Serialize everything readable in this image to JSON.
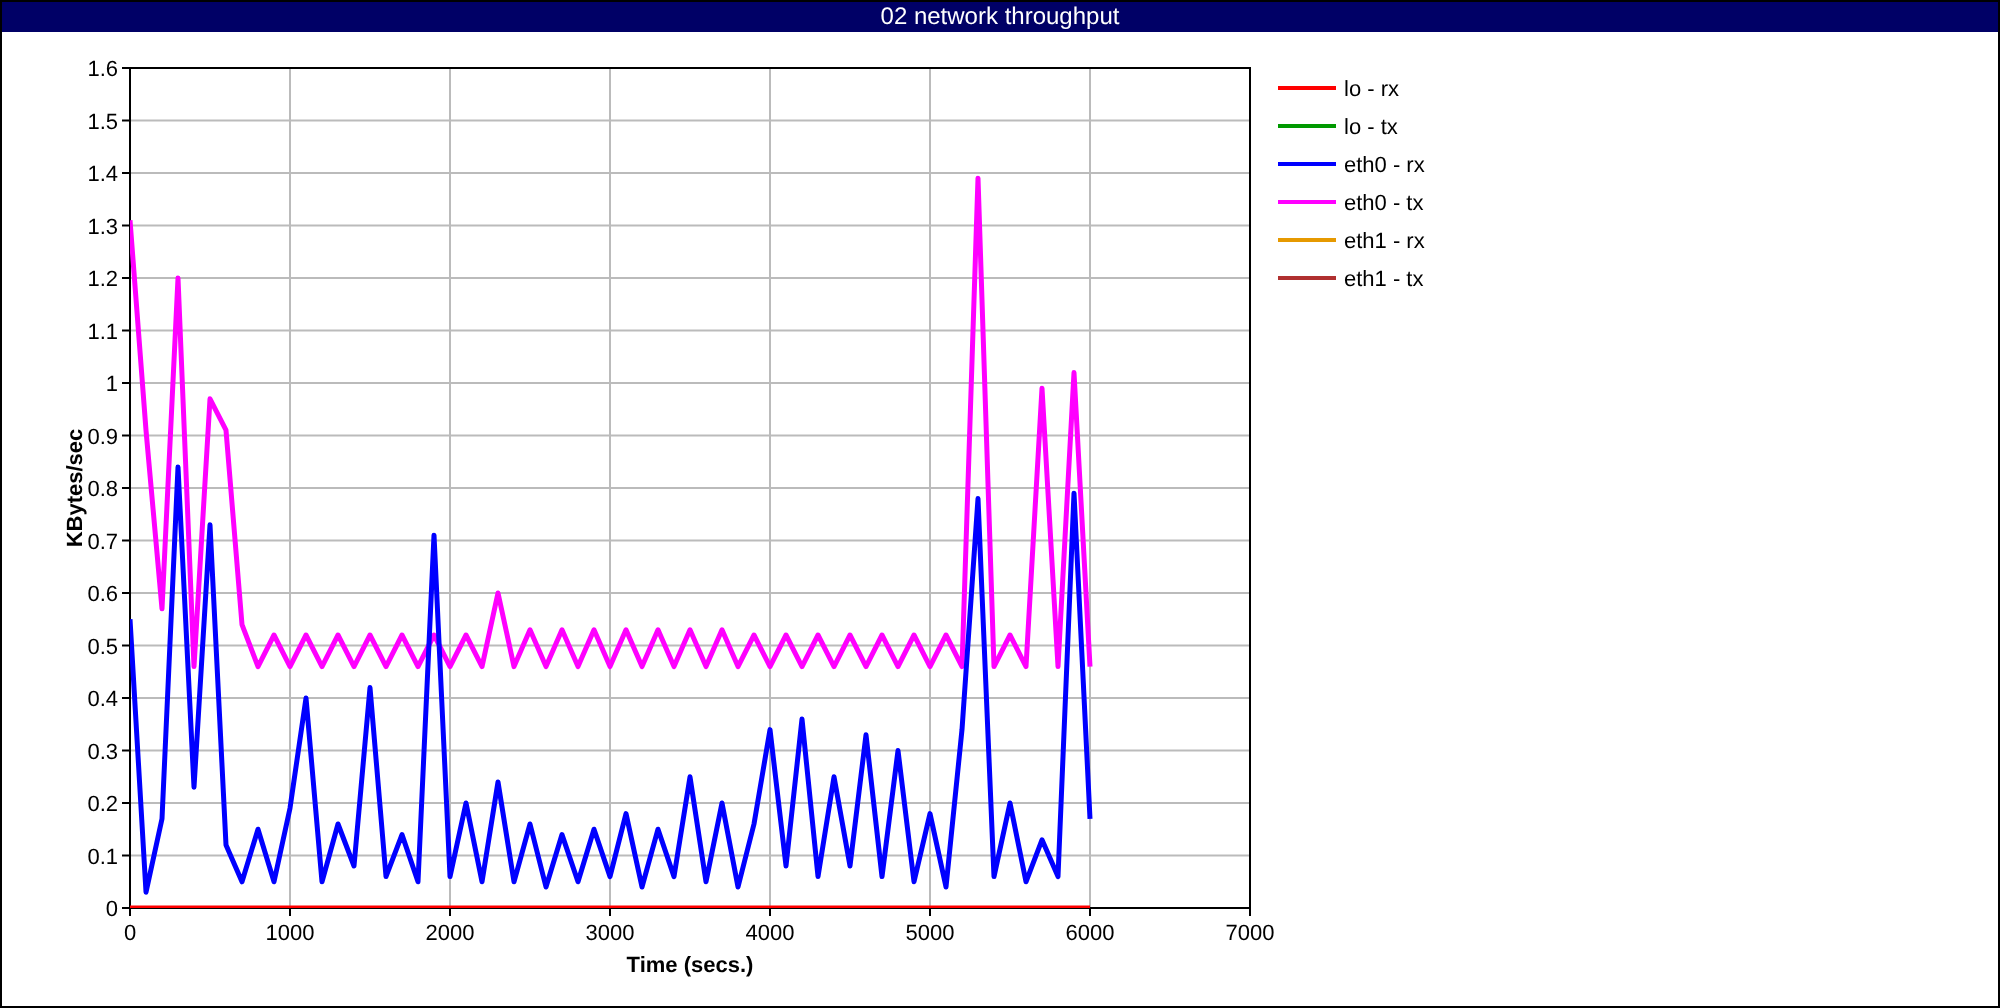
{
  "window": {
    "title": "02 network throughput"
  },
  "chart_data": {
    "type": "line",
    "xlabel": "Time (secs.)",
    "ylabel": "KBytes/sec",
    "xlim": [
      0,
      7000
    ],
    "ylim": [
      0,
      1.6
    ],
    "grid": true,
    "legend": true,
    "xticks": [
      0,
      1000,
      2000,
      3000,
      4000,
      5000,
      6000,
      7000
    ],
    "yticks": [
      0,
      0.1,
      0.2,
      0.3,
      0.4,
      0.5,
      0.6,
      0.7,
      0.8,
      0.9,
      1,
      1.1,
      1.2,
      1.3,
      1.4,
      1.5,
      1.6
    ],
    "x": [
      0,
      100,
      200,
      300,
      400,
      500,
      600,
      700,
      800,
      900,
      1000,
      1100,
      1200,
      1300,
      1400,
      1500,
      1600,
      1700,
      1800,
      1900,
      2000,
      2100,
      2200,
      2300,
      2400,
      2500,
      2600,
      2700,
      2800,
      2900,
      3000,
      3100,
      3200,
      3300,
      3400,
      3500,
      3600,
      3700,
      3800,
      3900,
      4000,
      4100,
      4200,
      4300,
      4400,
      4500,
      4600,
      4700,
      4800,
      4900,
      5000,
      5100,
      5200,
      5300,
      5400,
      5500,
      5600,
      5700,
      5800,
      5900,
      6000
    ],
    "series": [
      {
        "name": "lo - rx",
        "color": "#ff0000",
        "values": [
          0,
          0,
          0,
          0,
          0,
          0,
          0,
          0,
          0,
          0,
          0,
          0,
          0,
          0,
          0,
          0,
          0,
          0,
          0,
          0,
          0,
          0,
          0,
          0,
          0,
          0,
          0,
          0,
          0,
          0,
          0,
          0,
          0,
          0,
          0,
          0,
          0,
          0,
          0,
          0,
          0,
          0,
          0,
          0,
          0,
          0,
          0,
          0,
          0,
          0,
          0,
          0,
          0,
          0,
          0,
          0,
          0,
          0,
          0,
          0,
          0
        ]
      },
      {
        "name": "lo - tx",
        "color": "#009900",
        "values": [
          null,
          null,
          null,
          null,
          null,
          null,
          null,
          null,
          null,
          null,
          null,
          null,
          null,
          null,
          null,
          null,
          null,
          null,
          null,
          null,
          null,
          null,
          null,
          null,
          null,
          null,
          null,
          null,
          null,
          null,
          null,
          null,
          null,
          null,
          null,
          null,
          null,
          null,
          null,
          null,
          null,
          null,
          null,
          null,
          null,
          null,
          null,
          null,
          null,
          null,
          null,
          null,
          null,
          null,
          null,
          null,
          null,
          null,
          null,
          null,
          null
        ]
      },
      {
        "name": "eth0 - rx",
        "color": "#0000ff",
        "values": [
          0.55,
          0.03,
          0.17,
          0.84,
          0.23,
          0.73,
          0.12,
          0.05,
          0.15,
          0.05,
          0.19,
          0.4,
          0.05,
          0.16,
          0.08,
          0.42,
          0.06,
          0.14,
          0.05,
          0.71,
          0.06,
          0.2,
          0.05,
          0.24,
          0.05,
          0.16,
          0.04,
          0.14,
          0.05,
          0.15,
          0.06,
          0.18,
          0.04,
          0.15,
          0.06,
          0.25,
          0.05,
          0.2,
          0.04,
          0.16,
          0.34,
          0.08,
          0.36,
          0.06,
          0.25,
          0.08,
          0.33,
          0.06,
          0.3,
          0.05,
          0.18,
          0.04,
          0.34,
          0.78,
          0.06,
          0.2,
          0.05,
          0.13,
          0.06,
          0.79,
          0.17
        ]
      },
      {
        "name": "eth0 - tx",
        "color": "#ff00ff",
        "values": [
          1.31,
          0.91,
          0.57,
          1.2,
          0.46,
          0.97,
          0.91,
          0.54,
          0.46,
          0.52,
          0.46,
          0.52,
          0.46,
          0.52,
          0.46,
          0.52,
          0.46,
          0.52,
          0.46,
          0.52,
          0.46,
          0.52,
          0.46,
          0.6,
          0.46,
          0.53,
          0.46,
          0.53,
          0.46,
          0.53,
          0.46,
          0.53,
          0.46,
          0.53,
          0.46,
          0.53,
          0.46,
          0.53,
          0.46,
          0.52,
          0.46,
          0.52,
          0.46,
          0.52,
          0.46,
          0.52,
          0.46,
          0.52,
          0.46,
          0.52,
          0.46,
          0.52,
          0.46,
          1.39,
          0.46,
          0.52,
          0.46,
          0.99,
          0.46,
          1.02,
          0.46
        ]
      },
      {
        "name": "eth1 - rx",
        "color": "#e69900",
        "values": [
          null,
          null,
          null,
          null,
          null,
          null,
          null,
          null,
          null,
          null,
          null,
          null,
          null,
          null,
          null,
          null,
          null,
          null,
          null,
          null,
          null,
          null,
          null,
          null,
          null,
          null,
          null,
          null,
          null,
          null,
          null,
          null,
          null,
          null,
          null,
          null,
          null,
          null,
          null,
          null,
          null,
          null,
          null,
          null,
          null,
          null,
          null,
          null,
          null,
          null,
          null,
          null,
          null,
          null,
          null,
          null,
          null,
          null,
          null,
          null,
          null
        ]
      },
      {
        "name": "eth1 - tx",
        "color": "#b03030",
        "values": [
          null,
          null,
          null,
          null,
          null,
          null,
          null,
          null,
          null,
          null,
          null,
          null,
          null,
          null,
          null,
          null,
          null,
          null,
          null,
          null,
          null,
          null,
          null,
          null,
          null,
          null,
          null,
          null,
          null,
          null,
          null,
          null,
          null,
          null,
          null,
          null,
          null,
          null,
          null,
          null,
          null,
          null,
          null,
          null,
          null,
          null,
          null,
          null,
          null,
          null,
          null,
          null,
          null,
          null,
          null,
          null,
          null,
          null,
          null,
          null,
          null
        ]
      }
    ]
  }
}
